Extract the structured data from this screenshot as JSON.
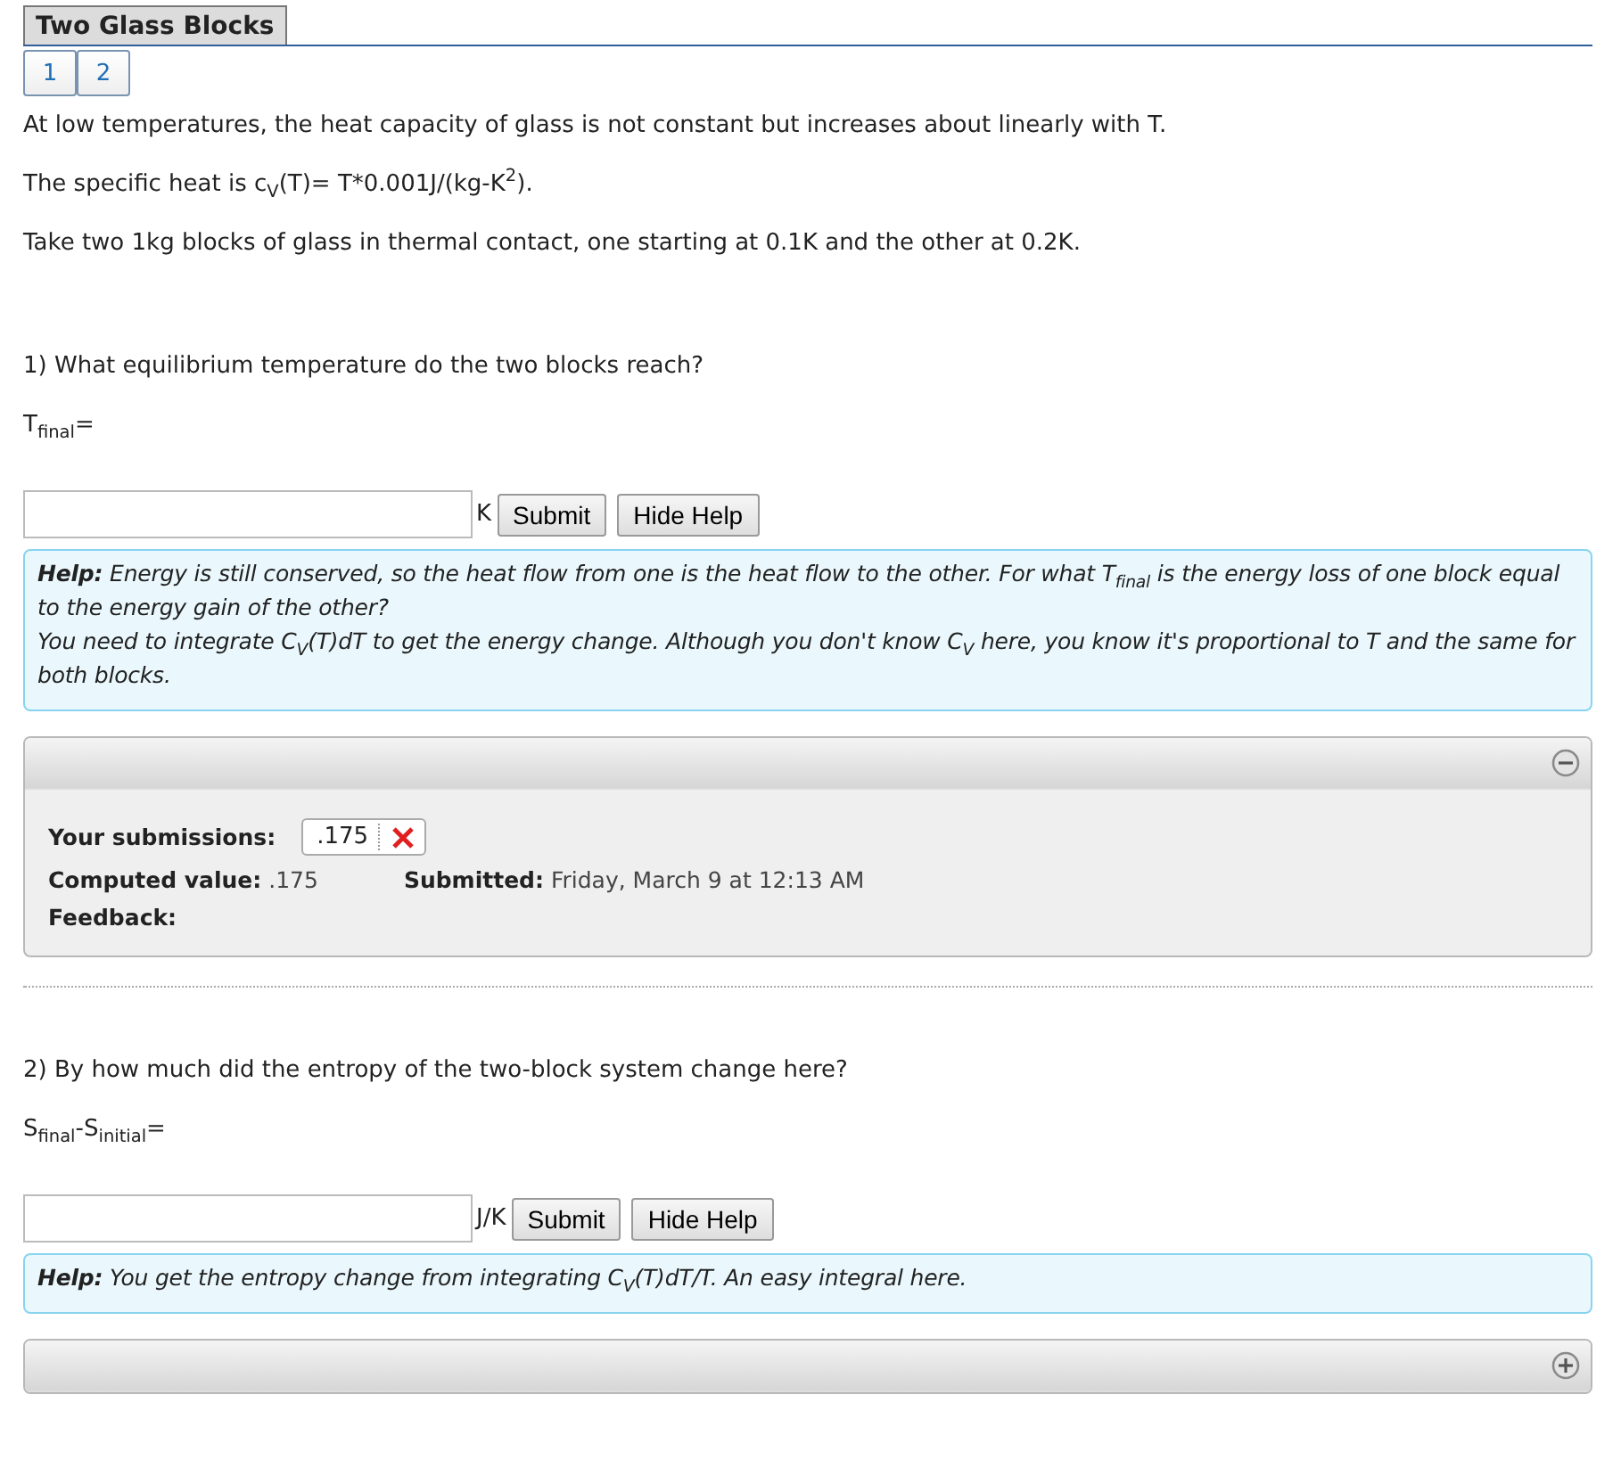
{
  "title": "Two Glass Blocks",
  "pages": [
    {
      "label": "1",
      "selected": false
    },
    {
      "label": "2",
      "selected": false
    }
  ],
  "intro": [
    "At low temperatures, the heat capacity of glass is not constant but increases about linearly with T.",
    "The specific heat is c$_{V}$(T)= T*0.001J/(kg-K$^{2}$).",
    "Take two 1kg blocks of glass in thermal contact, one starting at 0.1K and the other at 0.2K."
  ],
  "questions": [
    {
      "prompt": "1) What equilibrium temperature do the two blocks reach?",
      "label": "T$_{final}$=",
      "unit": "K",
      "submit": "Submit",
      "help_button": "Hide Help",
      "help": "**Help:** Energy is still conserved, so the heat flow from one is the heat flow to the other. For what T$_{final}$ is the energy loss of one block equal to the energy gain of the other?\nYou need to integrate C$_{V}$(T)dT to get the energy change. Although you don't know C$_{V}$ here, you know it's proportional to T and the same for both blocks.",
      "panel": {
        "expanded": true,
        "submissions_label": "Your submissions:",
        "submission": ".175",
        "correct": false,
        "computed_label": "Computed value:",
        "computed": ".175",
        "submitted_label": "Submitted:",
        "submitted": "Friday, March 9 at 12:13 AM",
        "feedback_label": "Feedback:"
      }
    },
    {
      "prompt": "2) By how much did the entropy of the two-block system change here?",
      "label": "S$_{final}$-S$_{initial}$=",
      "unit": "J/K",
      "submit": "Submit",
      "help_button": "Hide Help",
      "help": "**Help:** You get the entropy change from integrating C$_{V}$(T)dT/T. An easy integral here.",
      "panel": {
        "expanded": false
      }
    }
  ]
}
